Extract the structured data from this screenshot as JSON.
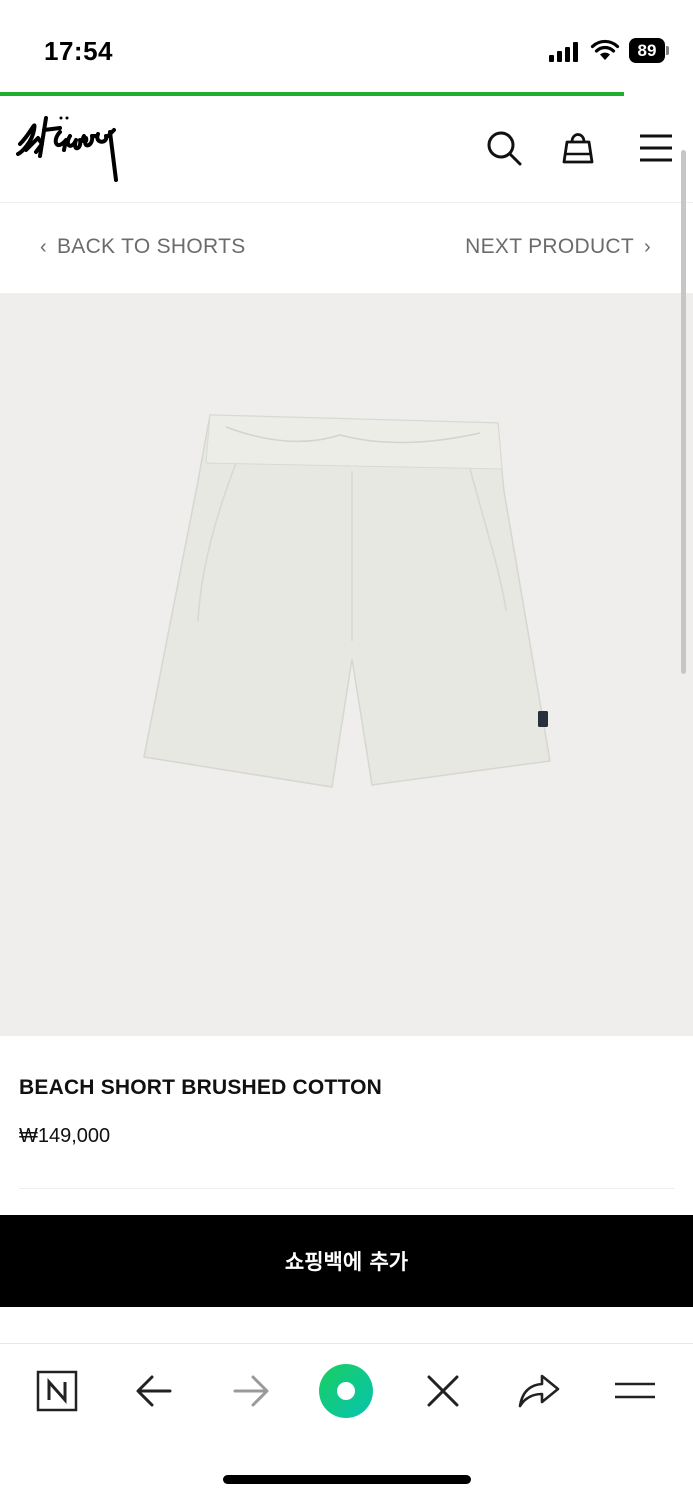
{
  "status_bar": {
    "time": "17:54",
    "battery": "89"
  },
  "page_load_progress": 0.9,
  "header": {
    "logo_alt": "Stüssy",
    "icons": [
      "search-icon",
      "shopping-bag-icon",
      "menu-icon"
    ]
  },
  "nav": {
    "back_label": "BACK TO SHORTS",
    "next_label": "NEXT PRODUCT"
  },
  "product": {
    "title": "BEACH SHORT BRUSHED COTTON",
    "price": "₩149,000",
    "image_alt": "Beach Short Brushed Cotton – light cream"
  },
  "actions": {
    "add_to_bag_label": "쇼핑백에 추가"
  },
  "browser_toolbar": {
    "icons": [
      "naver-icon",
      "back-arrow-icon",
      "forward-arrow-icon",
      "green-dot-icon",
      "close-icon",
      "share-icon",
      "menu-lines-icon"
    ]
  },
  "colors": {
    "accent_green": "#1fae2f",
    "image_bg": "#efeeec",
    "button_bg": "#000000"
  }
}
